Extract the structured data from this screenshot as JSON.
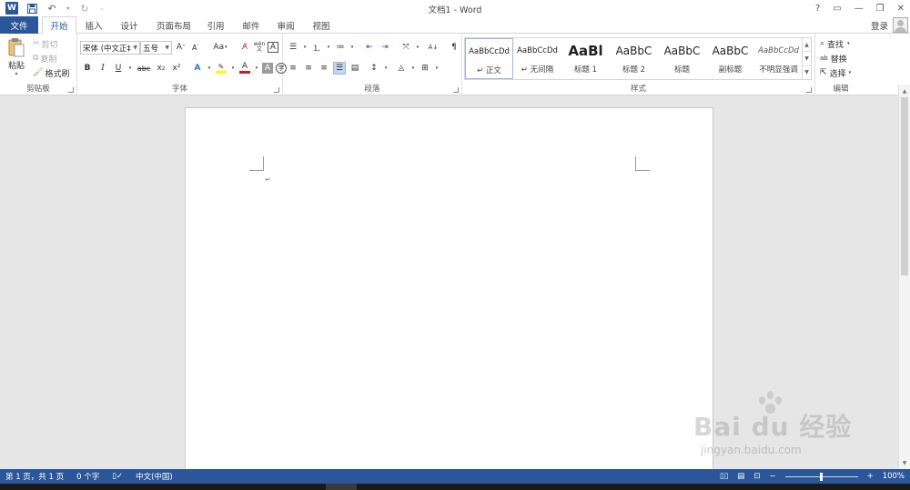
{
  "window": {
    "title": "文档1 - Word",
    "help": "?",
    "login": "登录"
  },
  "tabs": {
    "file": "文件",
    "items": [
      "开始",
      "插入",
      "设计",
      "页面布局",
      "引用",
      "邮件",
      "审阅",
      "视图"
    ],
    "active": "开始"
  },
  "clipboard": {
    "paste": "粘贴",
    "cut": "剪切",
    "copy": "复制",
    "format_painter": "格式刷",
    "label": "剪贴板"
  },
  "font": {
    "font_name": "宋体 (中文正‡",
    "font_size": "五号",
    "change_case": "Aa",
    "phonetic": "wén",
    "label": "字体",
    "bold": "B",
    "italic": "I",
    "underline": "U",
    "strikethrough": "abc",
    "subscript": "x₂",
    "superscript": "x²",
    "char_border": "A"
  },
  "paragraph": {
    "label": "段落"
  },
  "styles": {
    "label": "样式",
    "items": [
      {
        "sample": "AaBbCcDd",
        "name": "↵ 正文"
      },
      {
        "sample": "AaBbCcDd",
        "name": "↵ 无间隔"
      },
      {
        "sample": "AaBl",
        "name": "标题 1"
      },
      {
        "sample": "AaBbC",
        "name": "标题 2"
      },
      {
        "sample": "AaBbC",
        "name": "标题"
      },
      {
        "sample": "AaBbC",
        "name": "副标题"
      },
      {
        "sample": "AaBbCcDd",
        "name": "不明显强调"
      }
    ]
  },
  "editing": {
    "find": "查找",
    "replace": "替换",
    "select": "选择",
    "label": "编辑"
  },
  "document": {
    "paragraph_mark": "↵"
  },
  "status": {
    "page": "第 1 页，共 1 页",
    "words": "0 个字",
    "language": "中文(中国)",
    "zoom": "100%"
  },
  "watermark": {
    "logo": "Bai du 经验",
    "url": "jingyan.baidu.com"
  },
  "colors": {
    "accent": "#2b579a",
    "font_color": "#e81123",
    "highlight": "#ffff00"
  }
}
